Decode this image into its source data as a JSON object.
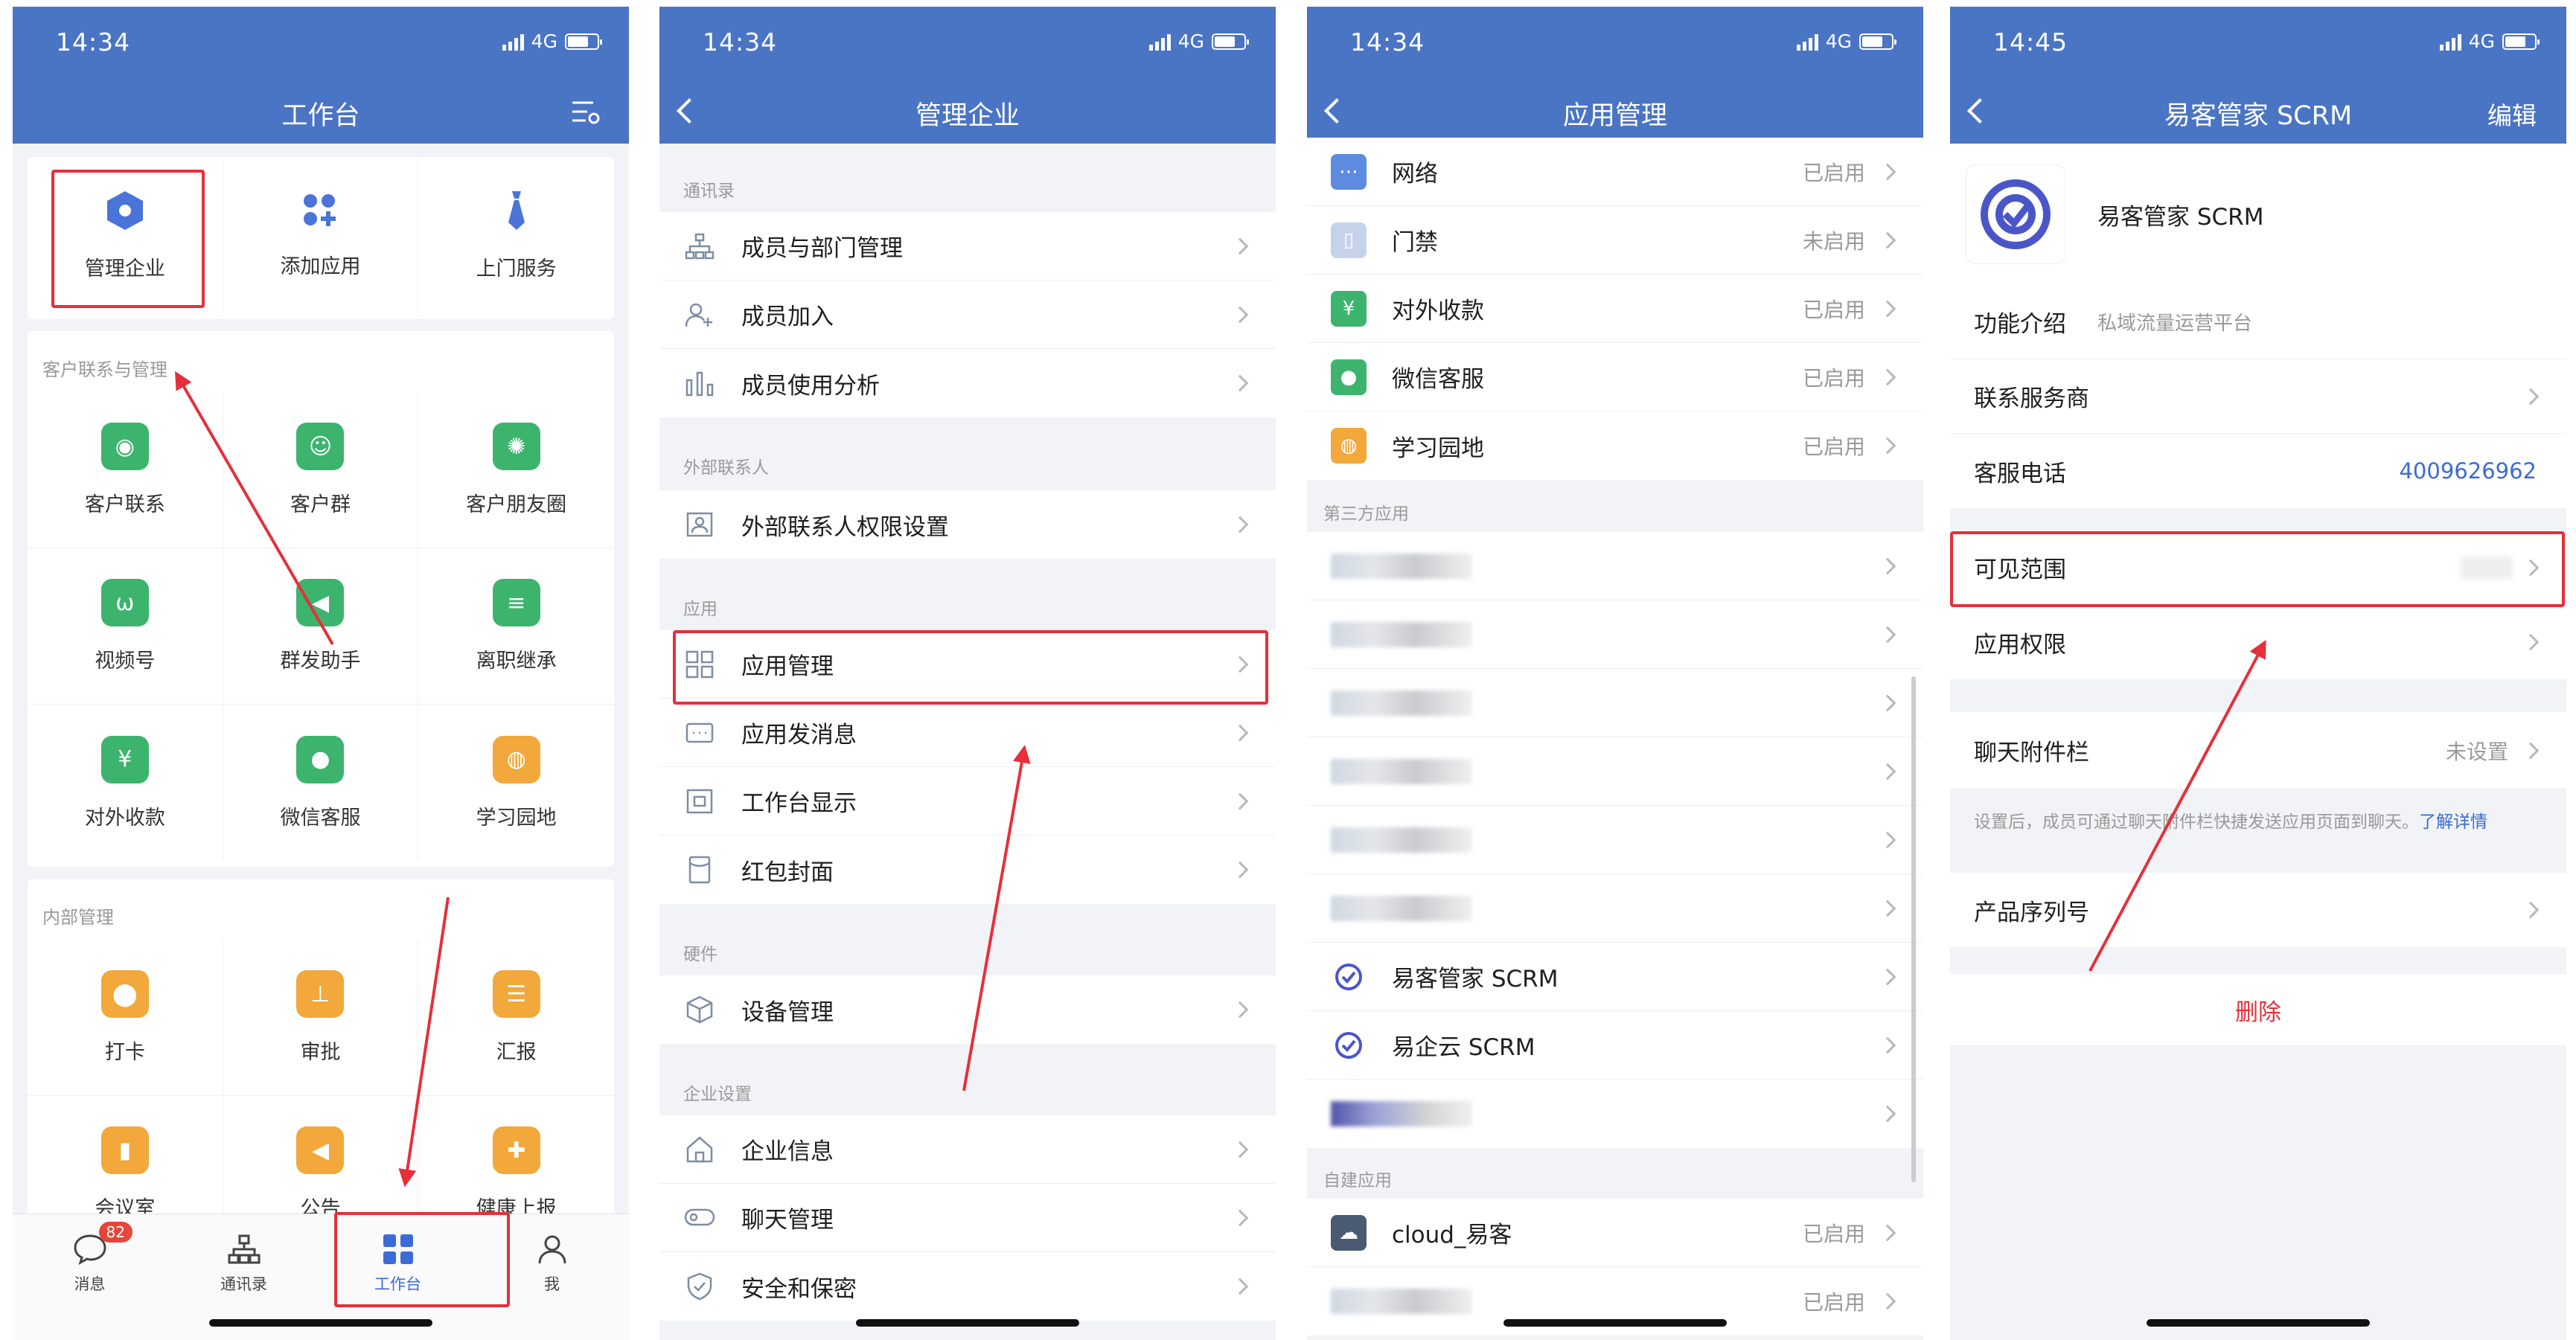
{
  "status": {
    "time_p1": "14:34",
    "time_p2": "14:34",
    "time_p3": "14:34",
    "time_p4": "14:45",
    "network": "4G"
  },
  "panel1": {
    "title": "工作台",
    "top_items": [
      {
        "label": "管理企业",
        "icon": "hexagon-icon",
        "color": "#4a74d8"
      },
      {
        "label": "添加应用",
        "icon": "add-apps-icon",
        "color": "#4a74d8"
      },
      {
        "label": "上门服务",
        "icon": "tie-icon",
        "color": "#4a74d8"
      }
    ],
    "section1_title": "客户联系与管理",
    "section1_items": [
      {
        "label": "客户联系",
        "icon": "chat-icon",
        "color": "#3cb46e"
      },
      {
        "label": "客户群",
        "icon": "group-icon",
        "color": "#3cb46e"
      },
      {
        "label": "客户朋友圈",
        "icon": "moments-icon",
        "color": "#3cb46e"
      },
      {
        "label": "视频号",
        "icon": "video-channel-icon",
        "color": "#3cb46e"
      },
      {
        "label": "群发助手",
        "icon": "megaphone-icon",
        "color": "#3cb46e"
      },
      {
        "label": "离职继承",
        "icon": "handover-icon",
        "color": "#3cb46e"
      },
      {
        "label": "对外收款",
        "icon": "yuan-icon",
        "color": "#3cb46e"
      },
      {
        "label": "微信客服",
        "icon": "service-chat-icon",
        "color": "#3cb46e"
      },
      {
        "label": "学习园地",
        "icon": "planet-icon",
        "color": "#f2a83a"
      }
    ],
    "section2_title": "内部管理",
    "section2_items": [
      {
        "label": "打卡",
        "icon": "location-pin-icon",
        "color": "#f2a83a"
      },
      {
        "label": "审批",
        "icon": "stamp-icon",
        "color": "#f2a83a"
      },
      {
        "label": "汇报",
        "icon": "report-icon",
        "color": "#f2a83a"
      },
      {
        "label": "会议室",
        "icon": "door-icon",
        "color": "#f2a83a"
      },
      {
        "label": "公告",
        "icon": "bullhorn-icon",
        "color": "#f2a83a"
      },
      {
        "label": "健康上报",
        "icon": "health-icon",
        "color": "#f2a83a"
      }
    ],
    "tabs": [
      {
        "label": "消息",
        "icon": "message-icon",
        "badge": "82"
      },
      {
        "label": "通讯录",
        "icon": "contacts-icon"
      },
      {
        "label": "工作台",
        "icon": "workbench-icon"
      },
      {
        "label": "我",
        "icon": "profile-icon"
      }
    ]
  },
  "panel2": {
    "title": "管理企业",
    "groups": [
      {
        "label": "通讯录",
        "rows": [
          {
            "label": "成员与部门管理",
            "icon": "org-tree-icon"
          },
          {
            "label": "成员加入",
            "icon": "add-member-icon"
          },
          {
            "label": "成员使用分析",
            "icon": "bar-chart-icon"
          }
        ]
      },
      {
        "label": "外部联系人",
        "rows": [
          {
            "label": "外部联系人权限设置",
            "icon": "contact-card-icon"
          }
        ]
      },
      {
        "label": "应用",
        "rows": [
          {
            "label": "应用管理",
            "icon": "app-grid-icon"
          },
          {
            "label": "应用发消息",
            "icon": "message-box-icon"
          },
          {
            "label": "工作台显示",
            "icon": "display-icon"
          },
          {
            "label": "红包封面",
            "icon": "envelope-icon"
          }
        ]
      },
      {
        "label": "硬件",
        "rows": [
          {
            "label": "设备管理",
            "icon": "cube-icon"
          }
        ]
      },
      {
        "label": "企业设置",
        "rows": [
          {
            "label": "企业信息",
            "icon": "house-icon"
          },
          {
            "label": "聊天管理",
            "icon": "chat-bubble-icon"
          },
          {
            "label": "安全和保密",
            "icon": "shield-icon"
          }
        ]
      }
    ]
  },
  "panel3": {
    "title": "应用管理",
    "builtin_rows": [
      {
        "label": "网络",
        "status": "已启用",
        "icon": "network-icon",
        "color": "#5d8be0"
      },
      {
        "label": "门禁",
        "status": "未启用",
        "icon": "door-access-icon",
        "color": "#c6d2ea"
      },
      {
        "label": "对外收款",
        "status": "已启用",
        "icon": "yuan-icon",
        "color": "#3cb46e"
      },
      {
        "label": "微信客服",
        "status": "已启用",
        "icon": "service-chat-icon",
        "color": "#3cb46e"
      },
      {
        "label": "学习园地",
        "status": "已启用",
        "icon": "planet-icon",
        "color": "#f2a83a"
      }
    ],
    "third_party_label": "第三方应用",
    "third_party_named": [
      {
        "label": "易客管家 SCRM",
        "icon": "scrm-logo-icon"
      },
      {
        "label": "易企云 SCRM",
        "icon": "scrm-logo-icon"
      }
    ],
    "custom_label": "自建应用",
    "custom_rows": [
      {
        "label": "cloud_易客",
        "status": "已启用",
        "icon": "cloud-app-icon"
      },
      {
        "label": "",
        "status": "已启用",
        "icon": "blurred-app-icon"
      }
    ]
  },
  "panel4": {
    "title": "易客管家 SCRM",
    "edit": "编辑",
    "app_name": "易客管家 SCRM",
    "intro_label": "功能介绍",
    "intro_value": "私域流量运营平台",
    "contact_provider": "联系服务商",
    "service_phone_label": "客服电话",
    "service_phone": "4009626962",
    "visible_range": "可见范围",
    "app_permissions": "应用权限",
    "chat_attachment": "聊天附件栏",
    "chat_attachment_value": "未设置",
    "chat_note": "设置后，成员可通过聊天附件栏快捷发送应用页面到聊天。",
    "learn_more": "了解详情",
    "serial_number": "产品序列号",
    "delete": "删除"
  }
}
